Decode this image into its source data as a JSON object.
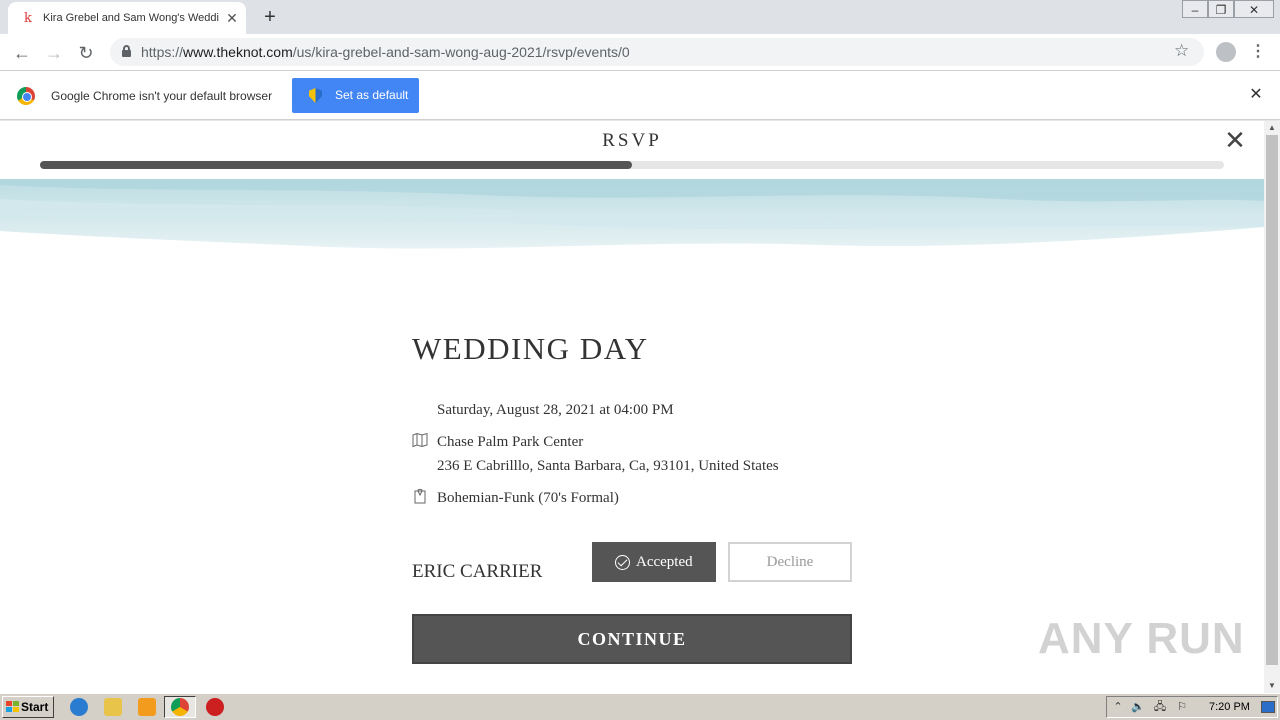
{
  "browser": {
    "tab_title": "Kira Grebel and Sam Wong's Wedding",
    "tab_favicon": "k",
    "url_prefix": "https://",
    "url_host": "www.theknot.com",
    "url_path": "/us/kira-grebel-and-sam-wong-aug-2021/rsvp/events/0"
  },
  "infobar": {
    "message": "Google Chrome isn't your default browser",
    "button_label": "Set as default"
  },
  "modal": {
    "title": "RSVP",
    "progress": 0.5
  },
  "event": {
    "title": "WEDDING DAY",
    "datetime": "Saturday, August 28, 2021 at 04:00 PM",
    "venue_name": "Chase Palm Park Center",
    "venue_address": "236 E Cabrilllo, Santa Barbara, Ca, 93101, United States",
    "attire": "Bohemian-Funk (70's Formal)"
  },
  "guest": {
    "name": "ERIC CARRIER",
    "accepted_label": "Accepted",
    "decline_label": "Decline"
  },
  "continue_label": "CONTINUE",
  "watermark": "ANY RUN",
  "taskbar": {
    "start_label": "Start",
    "clock": "7:20 PM"
  }
}
